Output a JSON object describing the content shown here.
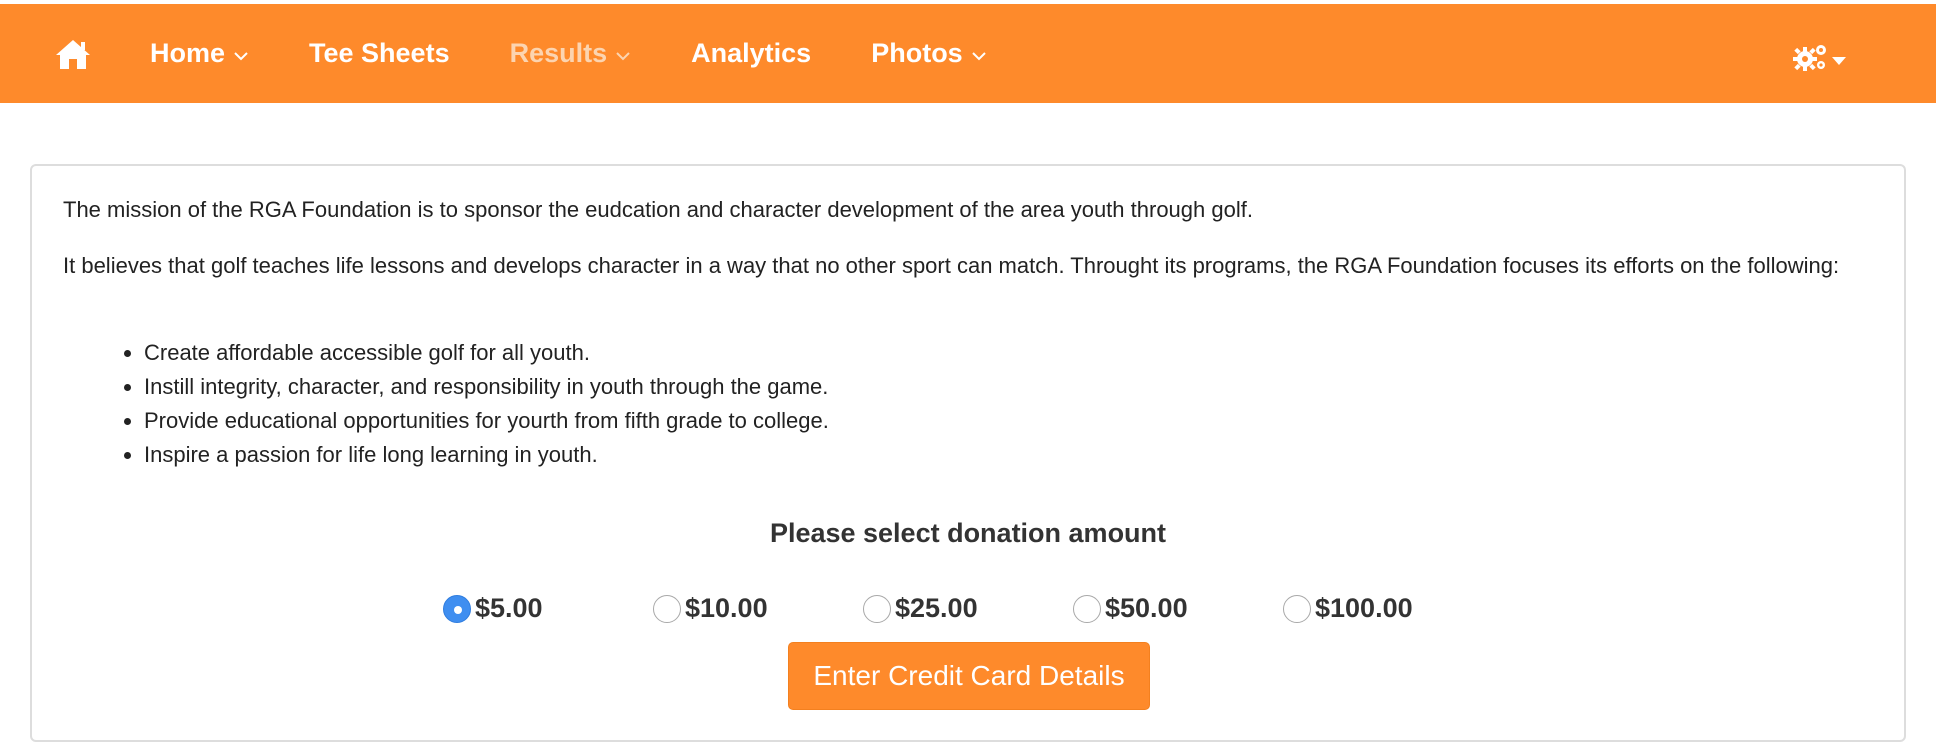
{
  "nav": {
    "items": [
      {
        "label": "Home",
        "dropdown": true
      },
      {
        "label": "Tee Sheets",
        "dropdown": false
      },
      {
        "label": "Results",
        "dropdown": true
      },
      {
        "label": "Analytics",
        "dropdown": false
      },
      {
        "label": "Photos",
        "dropdown": true
      }
    ],
    "home_icon": "home-icon",
    "settings_icon": "gears-icon"
  },
  "content": {
    "mission": "The mission of the RGA Foundation is to sponsor the eudcation and character development of the area youth through golf.",
    "belief": "It believes that golf teaches life lessons and develops character in a way that no other sport can match. Throught its programs, the RGA Foundation focuses its efforts on the following:",
    "bullets": [
      "Create affordable accessible golf for all youth.",
      "Instill integrity, character, and responsibility in youth through the game.",
      "Provide educational opportunities for yourth from fifth grade to college.",
      "Inspire a passion for life long learning in youth."
    ]
  },
  "donation": {
    "title": "Please select donation amount",
    "amounts": [
      "$5.00",
      "$10.00",
      "$25.00",
      "$50.00",
      "$100.00"
    ],
    "selected": "$5.00",
    "button_label": "Enter Credit Card Details"
  },
  "colors": {
    "brand_orange": "#fe8a2b",
    "radio_blue": "#3f8ef0"
  }
}
